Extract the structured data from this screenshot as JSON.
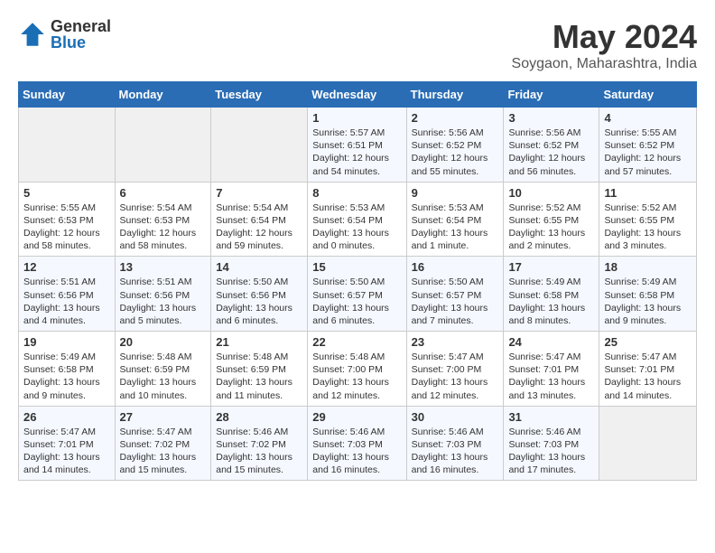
{
  "header": {
    "logo_general": "General",
    "logo_blue": "Blue",
    "main_title": "May 2024",
    "subtitle": "Soygaon, Maharashtra, India"
  },
  "weekdays": [
    "Sunday",
    "Monday",
    "Tuesday",
    "Wednesday",
    "Thursday",
    "Friday",
    "Saturday"
  ],
  "weeks": [
    [
      {
        "day": "",
        "info": ""
      },
      {
        "day": "",
        "info": ""
      },
      {
        "day": "",
        "info": ""
      },
      {
        "day": "1",
        "info": "Sunrise: 5:57 AM\nSunset: 6:51 PM\nDaylight: 12 hours\nand 54 minutes."
      },
      {
        "day": "2",
        "info": "Sunrise: 5:56 AM\nSunset: 6:52 PM\nDaylight: 12 hours\nand 55 minutes."
      },
      {
        "day": "3",
        "info": "Sunrise: 5:56 AM\nSunset: 6:52 PM\nDaylight: 12 hours\nand 56 minutes."
      },
      {
        "day": "4",
        "info": "Sunrise: 5:55 AM\nSunset: 6:52 PM\nDaylight: 12 hours\nand 57 minutes."
      }
    ],
    [
      {
        "day": "5",
        "info": "Sunrise: 5:55 AM\nSunset: 6:53 PM\nDaylight: 12 hours\nand 58 minutes."
      },
      {
        "day": "6",
        "info": "Sunrise: 5:54 AM\nSunset: 6:53 PM\nDaylight: 12 hours\nand 58 minutes."
      },
      {
        "day": "7",
        "info": "Sunrise: 5:54 AM\nSunset: 6:54 PM\nDaylight: 12 hours\nand 59 minutes."
      },
      {
        "day": "8",
        "info": "Sunrise: 5:53 AM\nSunset: 6:54 PM\nDaylight: 13 hours\nand 0 minutes."
      },
      {
        "day": "9",
        "info": "Sunrise: 5:53 AM\nSunset: 6:54 PM\nDaylight: 13 hours\nand 1 minute."
      },
      {
        "day": "10",
        "info": "Sunrise: 5:52 AM\nSunset: 6:55 PM\nDaylight: 13 hours\nand 2 minutes."
      },
      {
        "day": "11",
        "info": "Sunrise: 5:52 AM\nSunset: 6:55 PM\nDaylight: 13 hours\nand 3 minutes."
      }
    ],
    [
      {
        "day": "12",
        "info": "Sunrise: 5:51 AM\nSunset: 6:56 PM\nDaylight: 13 hours\nand 4 minutes."
      },
      {
        "day": "13",
        "info": "Sunrise: 5:51 AM\nSunset: 6:56 PM\nDaylight: 13 hours\nand 5 minutes."
      },
      {
        "day": "14",
        "info": "Sunrise: 5:50 AM\nSunset: 6:56 PM\nDaylight: 13 hours\nand 6 minutes."
      },
      {
        "day": "15",
        "info": "Sunrise: 5:50 AM\nSunset: 6:57 PM\nDaylight: 13 hours\nand 6 minutes."
      },
      {
        "day": "16",
        "info": "Sunrise: 5:50 AM\nSunset: 6:57 PM\nDaylight: 13 hours\nand 7 minutes."
      },
      {
        "day": "17",
        "info": "Sunrise: 5:49 AM\nSunset: 6:58 PM\nDaylight: 13 hours\nand 8 minutes."
      },
      {
        "day": "18",
        "info": "Sunrise: 5:49 AM\nSunset: 6:58 PM\nDaylight: 13 hours\nand 9 minutes."
      }
    ],
    [
      {
        "day": "19",
        "info": "Sunrise: 5:49 AM\nSunset: 6:58 PM\nDaylight: 13 hours\nand 9 minutes."
      },
      {
        "day": "20",
        "info": "Sunrise: 5:48 AM\nSunset: 6:59 PM\nDaylight: 13 hours\nand 10 minutes."
      },
      {
        "day": "21",
        "info": "Sunrise: 5:48 AM\nSunset: 6:59 PM\nDaylight: 13 hours\nand 11 minutes."
      },
      {
        "day": "22",
        "info": "Sunrise: 5:48 AM\nSunset: 7:00 PM\nDaylight: 13 hours\nand 12 minutes."
      },
      {
        "day": "23",
        "info": "Sunrise: 5:47 AM\nSunset: 7:00 PM\nDaylight: 13 hours\nand 12 minutes."
      },
      {
        "day": "24",
        "info": "Sunrise: 5:47 AM\nSunset: 7:01 PM\nDaylight: 13 hours\nand 13 minutes."
      },
      {
        "day": "25",
        "info": "Sunrise: 5:47 AM\nSunset: 7:01 PM\nDaylight: 13 hours\nand 14 minutes."
      }
    ],
    [
      {
        "day": "26",
        "info": "Sunrise: 5:47 AM\nSunset: 7:01 PM\nDaylight: 13 hours\nand 14 minutes."
      },
      {
        "day": "27",
        "info": "Sunrise: 5:47 AM\nSunset: 7:02 PM\nDaylight: 13 hours\nand 15 minutes."
      },
      {
        "day": "28",
        "info": "Sunrise: 5:46 AM\nSunset: 7:02 PM\nDaylight: 13 hours\nand 15 minutes."
      },
      {
        "day": "29",
        "info": "Sunrise: 5:46 AM\nSunset: 7:03 PM\nDaylight: 13 hours\nand 16 minutes."
      },
      {
        "day": "30",
        "info": "Sunrise: 5:46 AM\nSunset: 7:03 PM\nDaylight: 13 hours\nand 16 minutes."
      },
      {
        "day": "31",
        "info": "Sunrise: 5:46 AM\nSunset: 7:03 PM\nDaylight: 13 hours\nand 17 minutes."
      },
      {
        "day": "",
        "info": ""
      }
    ]
  ]
}
